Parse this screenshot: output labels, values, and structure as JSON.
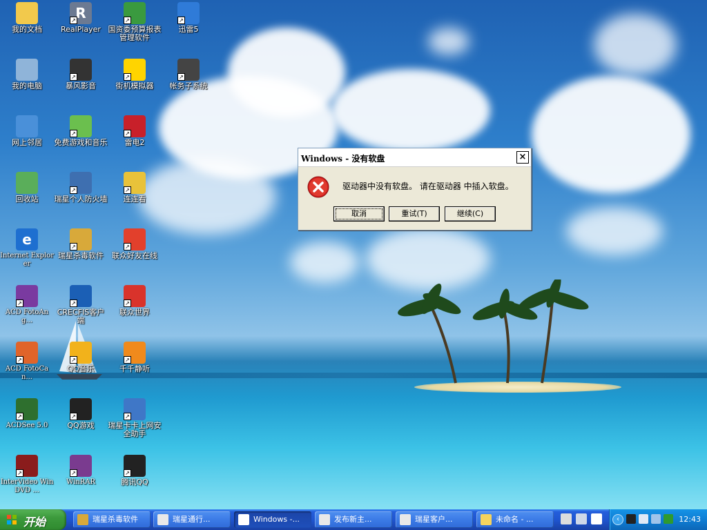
{
  "desktop": {
    "icons": [
      {
        "label": "我的文档",
        "icon": "folder-documents-icon",
        "color": "#f2c94c",
        "glyph": "",
        "shortcut": false,
        "col": 0,
        "row": 0
      },
      {
        "label": "RealPlayer",
        "icon": "realplayer-icon",
        "color": "#6c7a92",
        "glyph": "R",
        "shortcut": true,
        "col": 1,
        "row": 0
      },
      {
        "label": "国资委预算报表管理软件",
        "icon": "budget-software-icon",
        "color": "#3a9a3f",
        "glyph": "",
        "shortcut": true,
        "col": 2,
        "row": 0
      },
      {
        "label": "迅雷5",
        "icon": "thunder-icon",
        "color": "#2f7bd8",
        "glyph": "",
        "shortcut": true,
        "col": 3,
        "row": 0
      },
      {
        "label": "我的电脑",
        "icon": "my-computer-icon",
        "color": "#8fb4d9",
        "glyph": "",
        "shortcut": false,
        "col": 0,
        "row": 1
      },
      {
        "label": "暴风影音",
        "icon": "storm-player-icon",
        "color": "#333333",
        "glyph": "",
        "shortcut": true,
        "col": 1,
        "row": 1
      },
      {
        "label": "街机模拟器",
        "icon": "arcade-emulator-icon",
        "color": "#ffd400",
        "glyph": "",
        "shortcut": true,
        "col": 2,
        "row": 1
      },
      {
        "label": "帐务子系统",
        "icon": "accounting-system-icon",
        "color": "#444444",
        "glyph": "",
        "shortcut": true,
        "col": 3,
        "row": 1
      },
      {
        "label": "网上邻居",
        "icon": "network-places-icon",
        "color": "#4a90d9",
        "glyph": "",
        "shortcut": false,
        "col": 0,
        "row": 2
      },
      {
        "label": "免费游戏和音乐",
        "icon": "free-games-gift-icon",
        "color": "#6bbf4e",
        "glyph": "",
        "shortcut": true,
        "col": 1,
        "row": 2
      },
      {
        "label": "雷电2",
        "icon": "raiden-icon",
        "color": "#c8202a",
        "glyph": "",
        "shortcut": true,
        "col": 2,
        "row": 2
      },
      {
        "label": "回收站",
        "icon": "recycle-bin-icon",
        "color": "#5aae5a",
        "glyph": "",
        "shortcut": false,
        "col": 0,
        "row": 3
      },
      {
        "label": "瑞星个人防火墙",
        "icon": "firewall-icon",
        "color": "#3e6fb0",
        "glyph": "",
        "shortcut": true,
        "col": 1,
        "row": 3
      },
      {
        "label": "连连看",
        "icon": "lianliankan-icon",
        "color": "#e8c23a",
        "glyph": "",
        "shortcut": true,
        "col": 2,
        "row": 3
      },
      {
        "label": "Internet Explorer",
        "icon": "internet-explorer-icon",
        "color": "#1e6fd0",
        "glyph": "e",
        "shortcut": false,
        "col": 0,
        "row": 4,
        "mono": true
      },
      {
        "label": "瑞星杀毒软件",
        "icon": "rising-antivirus-icon",
        "color": "#d8a93a",
        "glyph": "",
        "shortcut": true,
        "col": 1,
        "row": 4
      },
      {
        "label": "联众好友在线",
        "icon": "ourgame-friends-icon",
        "color": "#e2402c",
        "glyph": "",
        "shortcut": true,
        "col": 2,
        "row": 4
      },
      {
        "label": "ACD FotoAng...",
        "icon": "acd-fotoangelo-icon",
        "color": "#7a3aa0",
        "glyph": "",
        "shortcut": true,
        "col": 0,
        "row": 5,
        "mono": true
      },
      {
        "label": "CRECFIS客户端",
        "icon": "crecfis-client-icon",
        "color": "#1b5fb5",
        "glyph": "",
        "shortcut": true,
        "col": 1,
        "row": 5
      },
      {
        "label": "联众世界",
        "icon": "ourgame-world-icon",
        "color": "#d9332b",
        "glyph": "",
        "shortcut": true,
        "col": 2,
        "row": 5
      },
      {
        "label": "ACD FotoCan...",
        "icon": "acd-fotocanvas-icon",
        "color": "#e0642a",
        "glyph": "",
        "shortcut": true,
        "col": 0,
        "row": 6,
        "mono": true
      },
      {
        "label": "QQ音乐",
        "icon": "qq-music-icon",
        "color": "#f2b21b",
        "glyph": "",
        "shortcut": true,
        "col": 1,
        "row": 6
      },
      {
        "label": "千千静听",
        "icon": "ttplayer-icon",
        "color": "#f08a1c",
        "glyph": "",
        "shortcut": true,
        "col": 2,
        "row": 6
      },
      {
        "label": "ACDSee 5.0",
        "icon": "acdsee-icon",
        "color": "#2e6f2e",
        "glyph": "",
        "shortcut": true,
        "col": 0,
        "row": 7,
        "mono": true
      },
      {
        "label": "QQ游戏",
        "icon": "qq-game-icon",
        "color": "#222222",
        "glyph": "",
        "shortcut": true,
        "col": 1,
        "row": 7
      },
      {
        "label": "瑞星卡卡上网安全助手",
        "icon": "kaka-assistant-icon",
        "color": "#3f77c7",
        "glyph": "",
        "shortcut": true,
        "col": 2,
        "row": 7
      },
      {
        "label": "InterVideo WinDVD ...",
        "icon": "windvd-icon",
        "color": "#8a1c1c",
        "glyph": "",
        "shortcut": true,
        "col": 0,
        "row": 8,
        "mono": true
      },
      {
        "label": "WinRAR",
        "icon": "winrar-icon",
        "color": "#7a3b8f",
        "glyph": "",
        "shortcut": true,
        "col": 1,
        "row": 8,
        "mono": true
      },
      {
        "label": "腾讯QQ",
        "icon": "tencent-qq-icon",
        "color": "#222222",
        "glyph": "",
        "shortcut": true,
        "col": 2,
        "row": 8
      }
    ]
  },
  "dialog": {
    "title": "Windows - 没有软盘",
    "close_label": "×",
    "message": "驱动器中没有软盘。 请在驱动器  中插入软盘。",
    "icon": "error-icon",
    "buttons": {
      "cancel": "取消",
      "retry": "重试(T)",
      "continue": "继续(C)"
    }
  },
  "taskbar": {
    "start_label": "开始",
    "tasks": [
      {
        "label": "瑞星杀毒软件",
        "icon": "rising-antivirus-icon",
        "color": "#d8a93a",
        "active": false
      },
      {
        "label": "瑞星通行...",
        "icon": "document-icon",
        "color": "#e8e8e8",
        "active": false
      },
      {
        "label": "Windows -...",
        "icon": "window-icon",
        "color": "#ffffff",
        "active": true
      },
      {
        "label": "发布新主...",
        "icon": "document-icon",
        "color": "#e8e8e8",
        "active": false
      },
      {
        "label": "瑞星客户...",
        "icon": "document-icon",
        "color": "#e8e8e8",
        "active": false
      },
      {
        "label": "未命名 - ...",
        "icon": "paint-icon",
        "color": "#f4d35e",
        "active": false
      }
    ],
    "quick_launch": [
      {
        "icon": "keyboard-icon",
        "color": "#dddddd"
      },
      {
        "icon": "pen-icon",
        "color": "#cfd8e8"
      },
      {
        "icon": "help-icon",
        "color": "#ffffff"
      }
    ],
    "tray": {
      "icons": [
        {
          "icon": "qq-tray-icon",
          "color": "#222222"
        },
        {
          "icon": "network-tray-icon",
          "color": "#dfe9f5"
        },
        {
          "icon": "display-tray-icon",
          "color": "#9fc4ea"
        },
        {
          "icon": "kaka-tray-icon",
          "color": "#2f9a2f"
        }
      ],
      "clock": "12:43"
    }
  }
}
